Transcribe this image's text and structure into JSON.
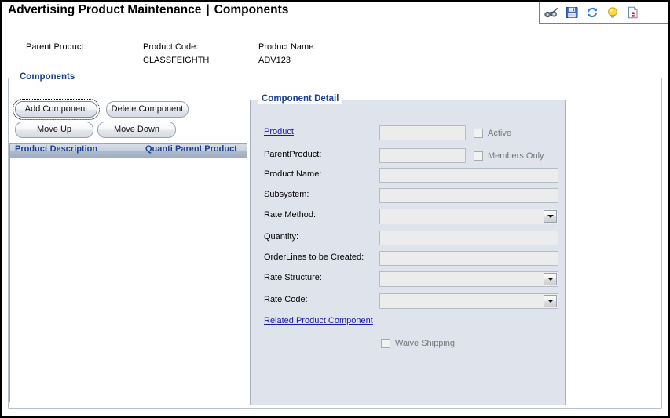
{
  "header": {
    "title_main": "Advertising Product Maintenance",
    "separator": "|",
    "title_sub": "Components"
  },
  "toolbar": {
    "items": [
      {
        "name": "binoculars-icon",
        "tooltip": "Search"
      },
      {
        "name": "save-icon",
        "tooltip": "Save"
      },
      {
        "name": "refresh-icon",
        "tooltip": "Refresh"
      },
      {
        "name": "lightbulb-icon",
        "tooltip": "Hint"
      },
      {
        "name": "report-icon",
        "tooltip": "Report"
      }
    ]
  },
  "product_info": {
    "parent_product_label": "Parent Product:",
    "parent_product_value": "",
    "product_code_label": "Product Code:",
    "product_code_value": "CLASSFEIGHTH",
    "product_name_label": "Product Name:",
    "product_name_value": "ADV123"
  },
  "components": {
    "legend": "Components",
    "buttons": {
      "add": "Add Component",
      "delete": "Delete Component",
      "move_up": "Move Up",
      "move_down": "Move Down"
    },
    "grid": {
      "columns": [
        "Product Description",
        "Quanti",
        "Parent Product"
      ],
      "rows": []
    }
  },
  "detail": {
    "legend": "Component Detail",
    "fields": {
      "product_link": "Product",
      "product_value": "",
      "parent_product_label": "ParentProduct:",
      "parent_product_value": "",
      "product_name_label": "Product Name:",
      "product_name_value": "",
      "subsystem_label": "Subsystem:",
      "subsystem_value": "",
      "rate_method_label": "Rate Method:",
      "rate_method_value": "",
      "quantity_label": "Quantity:",
      "quantity_value": "",
      "orderlines_label": "OrderLines to be Created:",
      "orderlines_value": "",
      "rate_structure_label": "Rate Structure:",
      "rate_structure_value": "",
      "rate_code_label": "Rate Code:",
      "rate_code_value": ""
    },
    "checkboxes": {
      "active": "Active",
      "members_only": "Members Only",
      "waive_shipping": "Waive Shipping"
    },
    "related_link": "Related Product Component"
  },
  "colors": {
    "legend_blue": "#1c3f8f",
    "link_blue": "#1a1aa8",
    "detail_bg": "#dfe3ec",
    "grid_header": "#aebbcd",
    "disabled_text": "#777777"
  }
}
